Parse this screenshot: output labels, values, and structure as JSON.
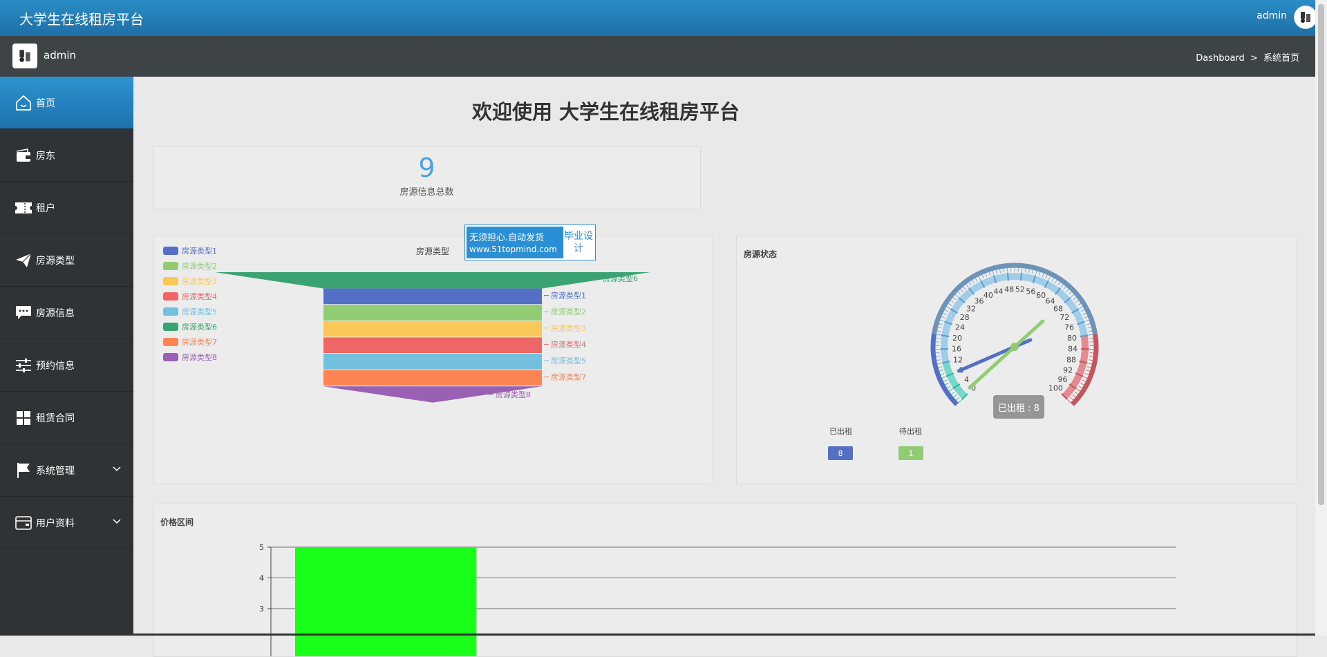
{
  "header": {
    "title": "大学生在线租房平台",
    "user": "admin"
  },
  "subheader": {
    "user": "admin",
    "breadcrumb_root": "Dashboard",
    "breadcrumb_sep": ">",
    "breadcrumb_current": "系统首页"
  },
  "sidebar": {
    "items": [
      {
        "label": "首页",
        "icon": "home-icon"
      },
      {
        "label": "房东",
        "icon": "wallet-icon"
      },
      {
        "label": "租户",
        "icon": "ticket-icon"
      },
      {
        "label": "房源类型",
        "icon": "paper-plane-icon"
      },
      {
        "label": "房源信息",
        "icon": "chat-icon"
      },
      {
        "label": "预约信息",
        "icon": "sliders-icon"
      },
      {
        "label": "租赁合同",
        "icon": "grid-icon"
      },
      {
        "label": "系统管理",
        "icon": "flag-icon"
      },
      {
        "label": "用户资料",
        "icon": "card-icon"
      }
    ]
  },
  "welcome": "欢迎使用 大学生在线租房平台",
  "stat": {
    "value": "9",
    "label": "房源信息总数"
  },
  "funnel": {
    "title": "房源类型",
    "ad": {
      "line1": "无须担心.自动发货",
      "url": "www.51topmind.com",
      "side": "毕业设计"
    }
  },
  "gauge": {
    "title": "房源状态",
    "tooltip": "已出租 : 8",
    "legend": [
      {
        "label": "已出租",
        "value": "8",
        "color": "#5470c6"
      },
      {
        "label": "待出租",
        "value": "1",
        "color": "#91cc75"
      }
    ]
  },
  "price": {
    "title": "价格区间"
  },
  "chart_data": [
    {
      "type": "funnel",
      "title": "房源类型",
      "categories": [
        "房源类型1",
        "房源类型2",
        "房源类型3",
        "房源类型4",
        "房源类型5",
        "房源类型6",
        "房源类型7",
        "房源类型8"
      ],
      "colors": [
        "#5470c6",
        "#91cc75",
        "#fac858",
        "#ee6666",
        "#73c0de",
        "#3ba272",
        "#fc8452",
        "#9a60b4"
      ],
      "legend": "left"
    },
    {
      "type": "gauge",
      "title": "房源状态",
      "range": [
        0,
        100
      ],
      "ticks": [
        "0",
        "4",
        "8",
        "12",
        "16",
        "20",
        "24",
        "28",
        "32",
        "36",
        "40",
        "44",
        "48",
        "52",
        "56",
        "60",
        "64",
        "68",
        "72",
        "76",
        "80",
        "84",
        "88",
        "92",
        "96",
        "100"
      ],
      "series": [
        {
          "name": "已出租",
          "value": 8,
          "color": "#5470c6"
        },
        {
          "name": "待出租",
          "value": 1,
          "color": "#91cc75"
        }
      ]
    },
    {
      "type": "bar",
      "title": "价格区间",
      "yticks": [
        "3",
        "4",
        "5"
      ],
      "values": [
        5
      ],
      "bar_color": "#1aff1a"
    }
  ]
}
